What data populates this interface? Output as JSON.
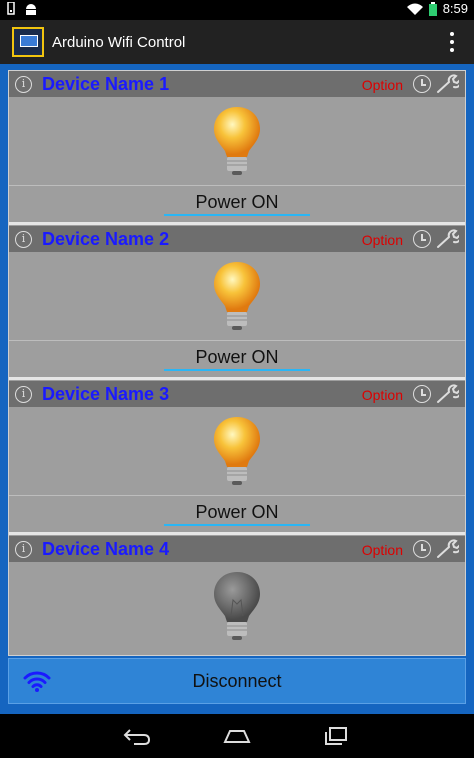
{
  "statusbar": {
    "time": "8:59"
  },
  "app": {
    "title": "Arduino Wifi Control"
  },
  "devices": [
    {
      "name": "Device Name 1",
      "option_label": "Option",
      "power_label": "Power ON",
      "bulb_state": "on"
    },
    {
      "name": "Device Name 2",
      "option_label": "Option",
      "power_label": "Power ON",
      "bulb_state": "on"
    },
    {
      "name": "Device Name 3",
      "option_label": "Option",
      "power_label": "Power ON",
      "bulb_state": "on"
    },
    {
      "name": "Device Name 4",
      "option_label": "Option",
      "power_label": "",
      "bulb_state": "off"
    }
  ],
  "disconnect": {
    "label": "Disconnect",
    "icon": "wifi-icon"
  },
  "colors": {
    "accent_blue": "#1565c0",
    "device_name": "#1a1aff",
    "option_red": "#dd0000",
    "bulb_on": "#f5a623",
    "bulb_off": "#6b6b6b"
  }
}
